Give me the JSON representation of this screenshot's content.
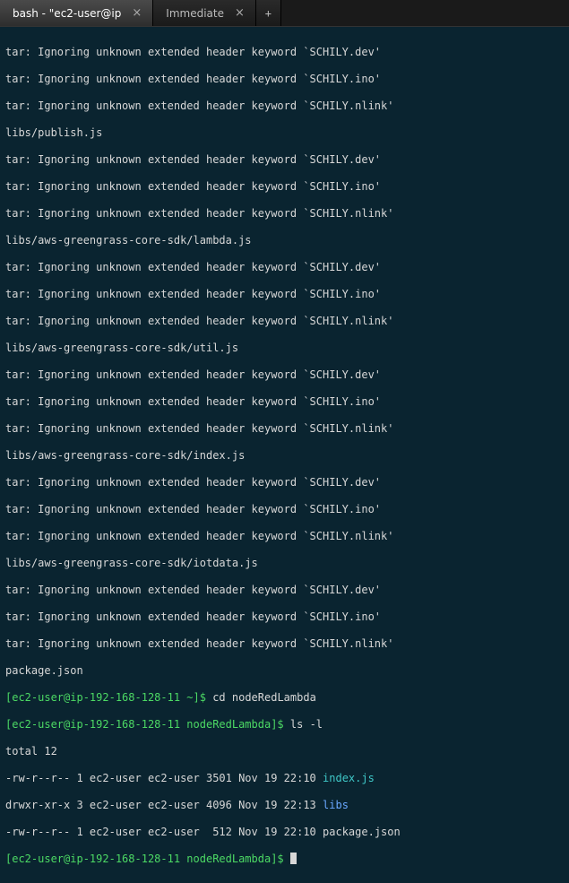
{
  "tabs": {
    "active_label": "bash - \"ec2-user@ip",
    "inactive_label": "Immediate"
  },
  "tar_block": {
    "dev": "tar: Ignoring unknown extended header keyword `SCHILY.dev'",
    "ino": "tar: Ignoring unknown extended header keyword `SCHILY.ino'",
    "nlink": "tar: Ignoring unknown extended header keyword `SCHILY.nlink'"
  },
  "files": {
    "f1": "libs/publish.js",
    "f2": "libs/aws-greengrass-core-sdk/lambda.js",
    "f3": "libs/aws-greengrass-core-sdk/util.js",
    "f4": "libs/aws-greengrass-core-sdk/index.js",
    "f5": "libs/aws-greengrass-core-sdk/iotdata.js",
    "f6": "package.json"
  },
  "prompt1": {
    "userhost": "[ec2-user@ip-192-168-128-11 ~]$",
    "cmd": " cd nodeRedLambda"
  },
  "prompt2": {
    "userhost": "[ec2-user@ip-192-168-128-11 nodeRedLambda]$",
    "cmd": " ls -l"
  },
  "ls": {
    "total": "total 12",
    "l1a": "-rw-r--r-- 1 ec2-user ec2-user 3501 Nov 19 22:10 ",
    "l1b": "index.js",
    "l2a": "drwxr-xr-x 3 ec2-user ec2-user 4096 Nov 19 22:13 ",
    "l2b": "libs",
    "l3a": "-rw-r--r-- 1 ec2-user ec2-user  512 Nov 19 22:10 ",
    "l3b": "package.json"
  },
  "prompt3": {
    "userhost": "[ec2-user@ip-192-168-128-11 nodeRedLambda]$",
    "cmd": " "
  }
}
